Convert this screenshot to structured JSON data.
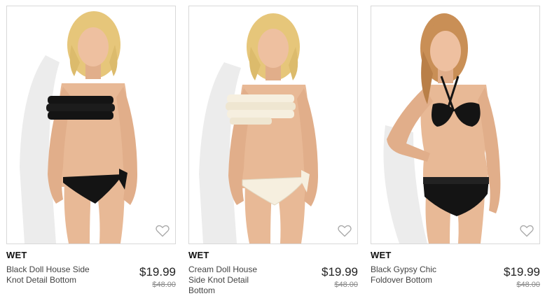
{
  "products": [
    {
      "brand": "WET",
      "name": "Black Doll House Side Knot Detail Bottom",
      "price": "$19.99",
      "original_price": "$48.00",
      "icon": "heart-outline-icon",
      "image": "model-black-ruffle-bandeau-bikini"
    },
    {
      "brand": "WET",
      "name": "Cream Doll House Side Knot Detail Bottom",
      "price": "$19.99",
      "original_price": "$48.00",
      "icon": "heart-outline-icon",
      "image": "model-cream-ruffle-bandeau-bikini"
    },
    {
      "brand": "WET",
      "name": "Black Gypsy Chic Foldover Bottom",
      "price": "$19.99",
      "original_price": "$48.00",
      "icon": "heart-outline-icon",
      "image": "model-black-halter-bikini"
    }
  ],
  "colors": {
    "skin": "#e8b996",
    "hair": "#e6c67a",
    "hair_auburn": "#c98f56",
    "black_swim": "#141414",
    "cream_swim": "#f6efdf",
    "shadow": "#e9e9e9",
    "border": "#d8d8d8"
  }
}
